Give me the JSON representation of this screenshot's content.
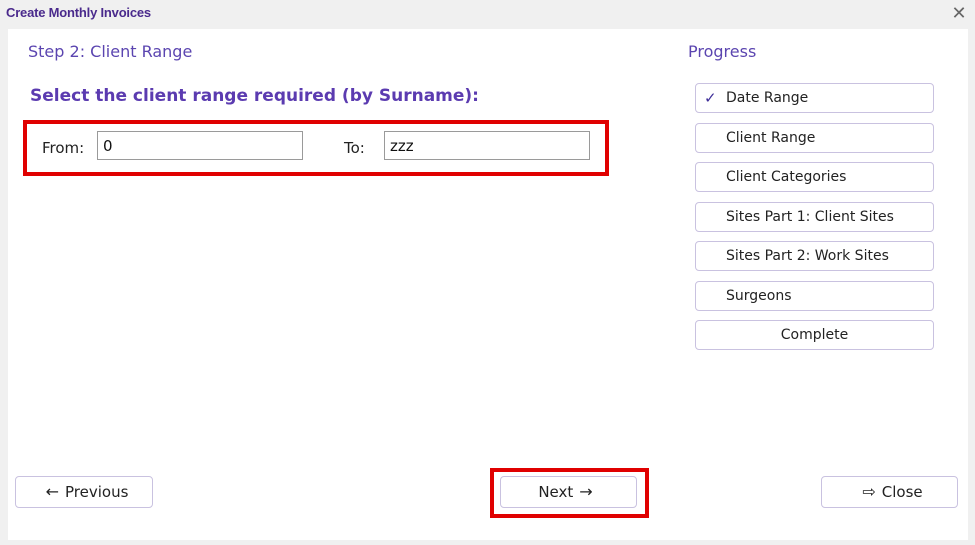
{
  "window": {
    "title": "Create Monthly Invoices",
    "close_glyph": "✕"
  },
  "step": {
    "title": "Step 2: Client Range",
    "instruction": "Select the client range required (by Surname):"
  },
  "range": {
    "from_label": "From:",
    "from_value": "0",
    "to_label": "To:",
    "to_value": "zzz"
  },
  "progress": {
    "title": "Progress",
    "items": [
      {
        "label": "Date Range",
        "completed": true,
        "icon": "check-icon"
      },
      {
        "label": "Client Range",
        "completed": false
      },
      {
        "label": "Client Categories",
        "completed": false
      },
      {
        "label": "Sites Part 1: Client Sites",
        "completed": false
      },
      {
        "label": "Sites Part 2: Work Sites",
        "completed": false
      },
      {
        "label": "Surgeons",
        "completed": false
      },
      {
        "label": "Complete",
        "completed": false
      }
    ]
  },
  "buttons": {
    "previous_label": "Previous",
    "next_label": "Next",
    "close_label": "Close",
    "previous_icon": "arrow-left-icon",
    "next_icon": "arrow-right-icon",
    "close_icon": "exit-icon"
  },
  "colors": {
    "accent": "#5b3bb0",
    "highlight": "#e00000",
    "panel": "#ffffff",
    "background": "#f0f0f0"
  }
}
